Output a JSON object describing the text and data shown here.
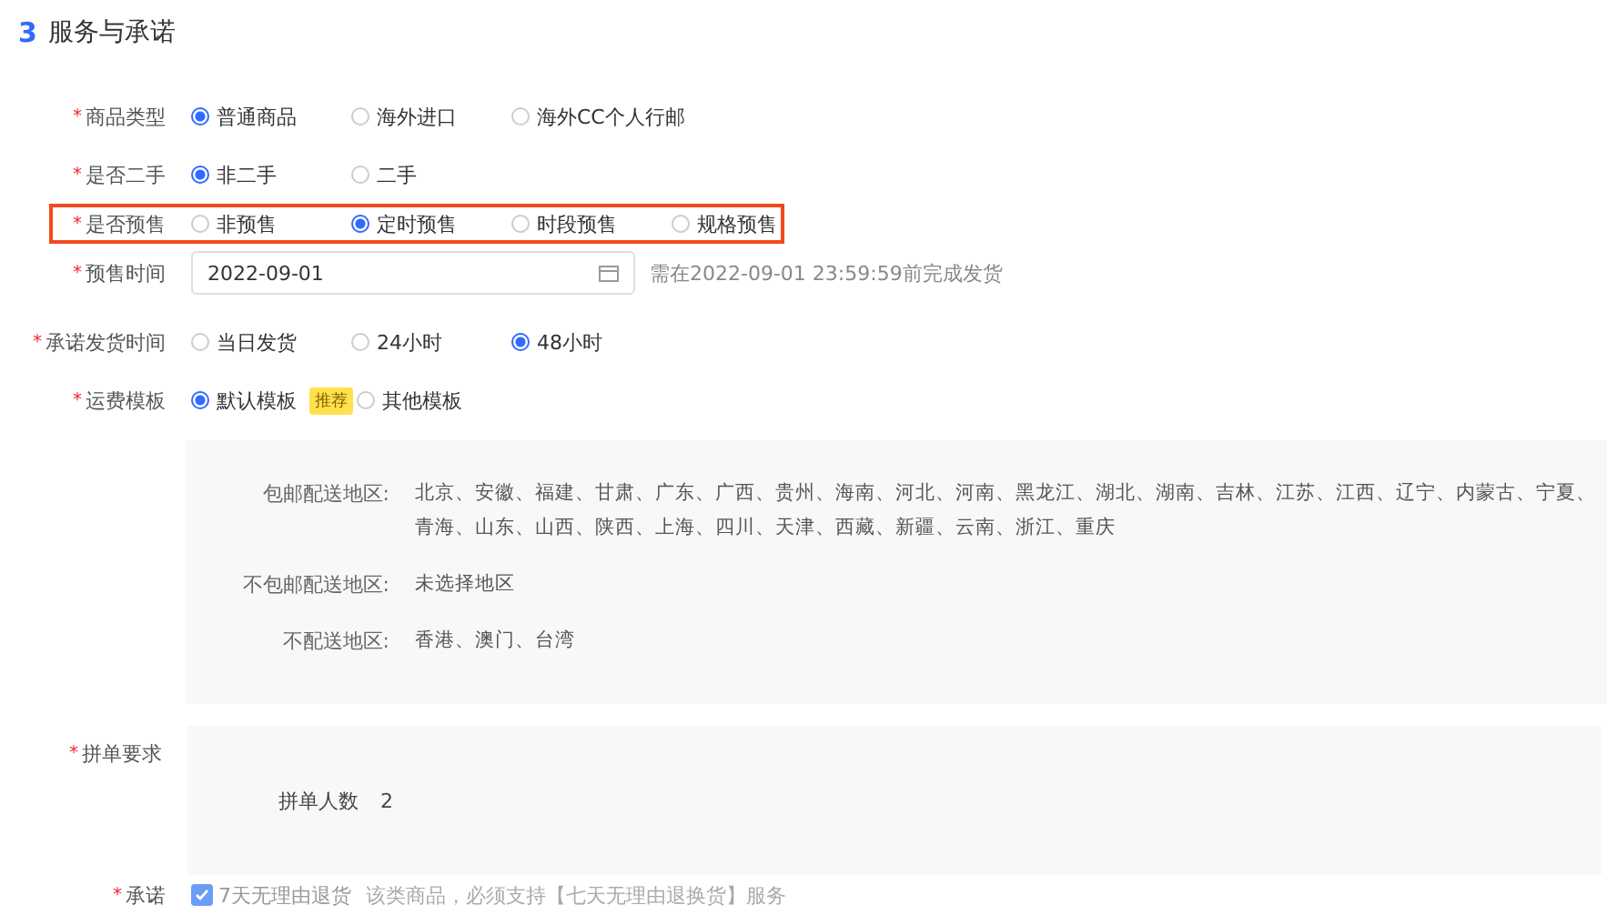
{
  "section": {
    "number": "3",
    "title": "服务与承诺"
  },
  "rows": [
    {
      "kind": "radio",
      "label": "商品类型",
      "marker": "*",
      "highlighted": false,
      "options": [
        {
          "label": "普通商品",
          "selected": true
        },
        {
          "label": "海外进口",
          "selected": false
        },
        {
          "label": "海外CC个人行邮",
          "selected": false
        }
      ]
    },
    {
      "kind": "radio",
      "label": "是否二手",
      "marker": "*",
      "highlighted": false,
      "options": [
        {
          "label": "非二手",
          "selected": true
        },
        {
          "label": "二手",
          "selected": false
        }
      ]
    },
    {
      "kind": "radio",
      "label": "是否预售",
      "marker": "*",
      "highlighted": true,
      "options": [
        {
          "label": "非预售",
          "selected": false
        },
        {
          "label": "定时预售",
          "selected": true
        },
        {
          "label": "时段预售",
          "selected": false
        },
        {
          "label": "规格预售",
          "selected": false
        }
      ]
    },
    {
      "kind": "date",
      "label": "预售时间",
      "marker": "*",
      "value": "2022-09-01",
      "hint": "需在2022-09-01 23:59:59前完成发货"
    },
    {
      "kind": "radio",
      "label": "承诺发货时间",
      "marker": "*",
      "highlighted": false,
      "options": [
        {
          "label": "当日发货",
          "selected": false
        },
        {
          "label": "24小时",
          "selected": false
        },
        {
          "label": "48小时",
          "selected": true
        }
      ]
    },
    {
      "kind": "radio",
      "label": "运费模板",
      "marker": "*",
      "highlighted": false,
      "options": [
        {
          "label": "默认模板",
          "selected": true,
          "badge": "推荐"
        },
        {
          "label": "其他模板",
          "selected": false
        }
      ]
    },
    {
      "kind": "regions",
      "entries": [
        {
          "label": "包邮配送地区:",
          "value": "北京、安徽、福建、甘肃、广东、广西、贵州、海南、河北、河南、黑龙江、湖北、湖南、吉林、江苏、江西、辽宁、内蒙古、宁夏、青海、山东、山西、陕西、上海、四川、天津、西藏、新疆、云南、浙江、重庆"
        },
        {
          "label": "不包邮配送地区:",
          "value": "未选择地区"
        },
        {
          "label": "不配送地区:",
          "value": "香港、澳门、台湾"
        }
      ]
    },
    {
      "kind": "group",
      "label": "拼单要求",
      "marker": "*",
      "entries": [
        {
          "label": "拼单人数",
          "value": "2"
        }
      ]
    },
    {
      "kind": "checkbox",
      "label": "承诺",
      "marker": "*",
      "checked": true,
      "text": "7天无理由退货",
      "note": "该类商品，必须支持【七天无理由退换货】服务"
    }
  ]
}
